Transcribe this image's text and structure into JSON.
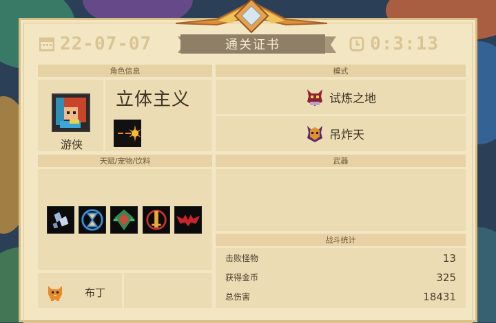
{
  "header": {
    "date": "22-07-07",
    "title": "通关证书",
    "time": "0:3:13"
  },
  "character": {
    "section_label": "角色信息",
    "hero_name": "游侠",
    "skin_name": "立体主义"
  },
  "mode": {
    "section_label": "模式",
    "entries": [
      {
        "label": "试炼之地",
        "icon": "trial-demon-icon"
      },
      {
        "label": "吊炸天",
        "icon": "badass-demon-icon"
      }
    ]
  },
  "buffs": {
    "section_label": "天赋/宠物/饮料",
    "items": [
      "crystal-shards-icon",
      "hourglass-icon",
      "green-gem-icon",
      "red-sword-shield-icon",
      "red-bat-wings-icon"
    ]
  },
  "pet": {
    "name": "布丁",
    "icon": "orange-cat-icon"
  },
  "weapons": {
    "section_label": "武器"
  },
  "stats": {
    "section_label": "战斗统计",
    "rows": [
      {
        "label": "击败怪物",
        "value": "13"
      },
      {
        "label": "获得金币",
        "value": "325"
      },
      {
        "label": "总伤害",
        "value": "18431"
      }
    ]
  },
  "colors": {
    "card_bg": "#f3e6c2",
    "panel_bg": "#ecdcb4",
    "header_bg": "#e6d2a4",
    "title_banner": "#8e7f66"
  }
}
